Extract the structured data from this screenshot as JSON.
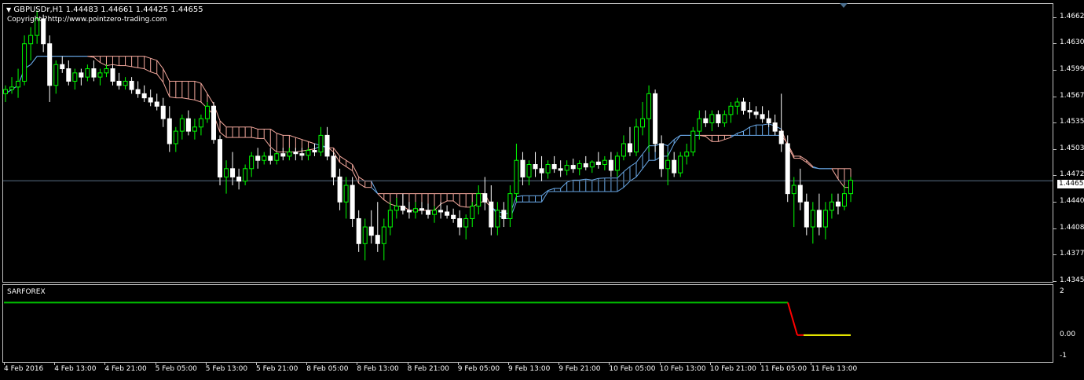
{
  "chart": {
    "symbol_line": "GBPUSDr,H1  1.44483 1.44661 1.44425 1.44655",
    "copyright": "Copyright ?http://www.pointzero-trading.com",
    "current_price": "1.44655",
    "colors": {
      "bull": "#00ff00",
      "bear": "#ffffff",
      "cloud_bull": "#6aa9e8",
      "cloud_bear": "#f5a99e",
      "sar_green": "#00c000",
      "sar_red": "#ff0000",
      "sar_yellow": "#ffff00"
    }
  },
  "price_axis": [
    "1.46620",
    "1.46305",
    "1.45990",
    "1.45670",
    "1.45355",
    "1.45035",
    "1.44720",
    "1.44405",
    "1.44085",
    "1.43770",
    "1.43450"
  ],
  "indicator": {
    "name": "SARFOREX",
    "axis": [
      "2",
      "0.00",
      "-1"
    ]
  },
  "time_axis": [
    "4 Feb 2016",
    "4 Feb 13:00",
    "4 Feb 21:00",
    "5 Feb 05:00",
    "5 Feb 13:00",
    "5 Feb 21:00",
    "8 Feb 05:00",
    "8 Feb 13:00",
    "8 Feb 21:00",
    "9 Feb 05:00",
    "9 Feb 13:00",
    "9 Feb 21:00",
    "10 Feb 05:00",
    "10 Feb 13:00",
    "10 Feb 21:00",
    "11 Feb 05:00",
    "11 Feb 13:00"
  ],
  "chart_data": {
    "type": "candlestick",
    "candles": [
      [
        1.457,
        1.458,
        1.456,
        1.4575
      ],
      [
        1.4575,
        1.459,
        1.457,
        1.4578
      ],
      [
        1.4578,
        1.46,
        1.4565,
        1.4585
      ],
      [
        1.4585,
        1.464,
        1.458,
        1.463
      ],
      [
        1.463,
        1.465,
        1.461,
        1.464
      ],
      [
        1.464,
        1.467,
        1.463,
        1.466
      ],
      [
        1.466,
        1.4665,
        1.462,
        1.463
      ],
      [
        1.463,
        1.464,
        1.456,
        1.458
      ],
      [
        1.458,
        1.461,
        1.457,
        1.4605
      ],
      [
        1.4605,
        1.4615,
        1.4595,
        1.46
      ],
      [
        1.46,
        1.461,
        1.458,
        1.4585
      ],
      [
        1.4585,
        1.46,
        1.4575,
        1.4595
      ],
      [
        1.4595,
        1.46,
        1.458,
        1.459
      ],
      [
        1.459,
        1.4605,
        1.4585,
        1.46
      ],
      [
        1.46,
        1.461,
        1.4585,
        1.459
      ],
      [
        1.459,
        1.46,
        1.458,
        1.4595
      ],
      [
        1.4595,
        1.4605,
        1.459,
        1.46
      ],
      [
        1.46,
        1.4605,
        1.458,
        1.4585
      ],
      [
        1.4585,
        1.4595,
        1.4575,
        1.458
      ],
      [
        1.458,
        1.459,
        1.4575,
        1.4585
      ],
      [
        1.4585,
        1.459,
        1.457,
        1.4575
      ],
      [
        1.4575,
        1.4585,
        1.4565,
        1.457
      ],
      [
        1.457,
        1.458,
        1.456,
        1.4565
      ],
      [
        1.4565,
        1.4575,
        1.4555,
        1.456
      ],
      [
        1.456,
        1.457,
        1.455,
        1.4555
      ],
      [
        1.4555,
        1.4565,
        1.453,
        1.454
      ],
      [
        1.454,
        1.4555,
        1.45,
        1.451
      ],
      [
        1.451,
        1.453,
        1.45,
        1.4525
      ],
      [
        1.4525,
        1.4545,
        1.4515,
        1.454
      ],
      [
        1.454,
        1.455,
        1.452,
        1.4525
      ],
      [
        1.4525,
        1.454,
        1.4515,
        1.453
      ],
      [
        1.453,
        1.4545,
        1.452,
        1.454
      ],
      [
        1.454,
        1.456,
        1.4535,
        1.4555
      ],
      [
        1.4555,
        1.456,
        1.451,
        1.4515
      ],
      [
        1.4515,
        1.452,
        1.446,
        1.447
      ],
      [
        1.447,
        1.449,
        1.445,
        1.448
      ],
      [
        1.448,
        1.45,
        1.446,
        1.447
      ],
      [
        1.447,
        1.448,
        1.4455,
        1.4465
      ],
      [
        1.4465,
        1.4485,
        1.446,
        1.448
      ],
      [
        1.448,
        1.45,
        1.447,
        1.4495
      ],
      [
        1.4495,
        1.4505,
        1.448,
        1.449
      ],
      [
        1.449,
        1.45,
        1.4485,
        1.4495
      ],
      [
        1.4495,
        1.4505,
        1.4485,
        1.449
      ],
      [
        1.449,
        1.45,
        1.4485,
        1.4498
      ],
      [
        1.4498,
        1.4505,
        1.449,
        1.4495
      ],
      [
        1.4495,
        1.4505,
        1.449,
        1.45
      ],
      [
        1.45,
        1.4505,
        1.449,
        1.4498
      ],
      [
        1.4498,
        1.4505,
        1.449,
        1.4496
      ],
      [
        1.4496,
        1.4505,
        1.449,
        1.4502
      ],
      [
        1.4502,
        1.451,
        1.4495,
        1.45
      ],
      [
        1.45,
        1.453,
        1.4495,
        1.452
      ],
      [
        1.452,
        1.453,
        1.449,
        1.4495
      ],
      [
        1.4495,
        1.45,
        1.446,
        1.447
      ],
      [
        1.447,
        1.448,
        1.443,
        1.444
      ],
      [
        1.444,
        1.447,
        1.442,
        1.446
      ],
      [
        1.446,
        1.447,
        1.441,
        1.442
      ],
      [
        1.442,
        1.443,
        1.438,
        1.439
      ],
      [
        1.439,
        1.442,
        1.437,
        1.441
      ],
      [
        1.441,
        1.443,
        1.439,
        1.44
      ],
      [
        1.44,
        1.444,
        1.438,
        1.439
      ],
      [
        1.439,
        1.442,
        1.437,
        1.441
      ],
      [
        1.441,
        1.444,
        1.44,
        1.443
      ],
      [
        1.443,
        1.4445,
        1.442,
        1.4435
      ],
      [
        1.4435,
        1.445,
        1.4425,
        1.443
      ],
      [
        1.443,
        1.444,
        1.442,
        1.4428
      ],
      [
        1.4428,
        1.444,
        1.442,
        1.4432
      ],
      [
        1.4432,
        1.444,
        1.4425,
        1.443
      ],
      [
        1.443,
        1.4438,
        1.442,
        1.4425
      ],
      [
        1.4425,
        1.4435,
        1.4415,
        1.443
      ],
      [
        1.443,
        1.444,
        1.442,
        1.4428
      ],
      [
        1.4428,
        1.4436,
        1.442,
        1.4424
      ],
      [
        1.4424,
        1.4432,
        1.4415,
        1.442
      ],
      [
        1.442,
        1.443,
        1.44,
        1.441
      ],
      [
        1.441,
        1.4425,
        1.4395,
        1.442
      ],
      [
        1.442,
        1.444,
        1.441,
        1.4435
      ],
      [
        1.4435,
        1.446,
        1.4425,
        1.445
      ],
      [
        1.445,
        1.447,
        1.443,
        1.444
      ],
      [
        1.444,
        1.446,
        1.44,
        1.441
      ],
      [
        1.441,
        1.444,
        1.44,
        1.443
      ],
      [
        1.443,
        1.444,
        1.441,
        1.442
      ],
      [
        1.442,
        1.446,
        1.441,
        1.445
      ],
      [
        1.445,
        1.451,
        1.444,
        1.449
      ],
      [
        1.449,
        1.45,
        1.446,
        1.447
      ],
      [
        1.447,
        1.449,
        1.446,
        1.4485
      ],
      [
        1.4485,
        1.45,
        1.447,
        1.448
      ],
      [
        1.448,
        1.4495,
        1.4465,
        1.4475
      ],
      [
        1.4475,
        1.449,
        1.4468,
        1.4485
      ],
      [
        1.4485,
        1.4495,
        1.4475,
        1.448
      ],
      [
        1.448,
        1.449,
        1.447,
        1.4478
      ],
      [
        1.4478,
        1.449,
        1.4472,
        1.4484
      ],
      [
        1.4484,
        1.4492,
        1.4475,
        1.448
      ],
      [
        1.448,
        1.449,
        1.4472,
        1.4486
      ],
      [
        1.4486,
        1.4495,
        1.4478,
        1.4482
      ],
      [
        1.4482,
        1.449,
        1.4475,
        1.4488
      ],
      [
        1.4488,
        1.45,
        1.448,
        1.4485
      ],
      [
        1.4485,
        1.4495,
        1.4478,
        1.449
      ],
      [
        1.449,
        1.45,
        1.447,
        1.4478
      ],
      [
        1.4478,
        1.45,
        1.447,
        1.4495
      ],
      [
        1.4495,
        1.452,
        1.449,
        1.451
      ],
      [
        1.451,
        1.453,
        1.4495,
        1.45
      ],
      [
        1.45,
        1.454,
        1.4495,
        1.453
      ],
      [
        1.453,
        1.456,
        1.452,
        1.454
      ],
      [
        1.454,
        1.458,
        1.45,
        1.457
      ],
      [
        1.457,
        1.4575,
        1.45,
        1.451
      ],
      [
        1.451,
        1.452,
        1.447,
        1.448
      ],
      [
        1.448,
        1.45,
        1.446,
        1.449
      ],
      [
        1.449,
        1.45,
        1.447,
        1.4475
      ],
      [
        1.4475,
        1.45,
        1.447,
        1.4495
      ],
      [
        1.4495,
        1.451,
        1.4485,
        1.45
      ],
      [
        1.45,
        1.453,
        1.4495,
        1.4525
      ],
      [
        1.4525,
        1.455,
        1.4515,
        1.454
      ],
      [
        1.454,
        1.455,
        1.453,
        1.4535
      ],
      [
        1.4535,
        1.455,
        1.4525,
        1.4545
      ],
      [
        1.4545,
        1.455,
        1.453,
        1.4535
      ],
      [
        1.4535,
        1.455,
        1.453,
        1.4545
      ],
      [
        1.4545,
        1.456,
        1.4535,
        1.4555
      ],
      [
        1.4555,
        1.4565,
        1.4545,
        1.456
      ],
      [
        1.456,
        1.4565,
        1.4545,
        1.455
      ],
      [
        1.455,
        1.456,
        1.454,
        1.4548
      ],
      [
        1.4548,
        1.4555,
        1.454,
        1.4545
      ],
      [
        1.4545,
        1.4555,
        1.4535,
        1.454
      ],
      [
        1.454,
        1.455,
        1.453,
        1.4535
      ],
      [
        1.4535,
        1.4545,
        1.452,
        1.4525
      ],
      [
        1.4525,
        1.457,
        1.45,
        1.451
      ],
      [
        1.451,
        1.452,
        1.444,
        1.445
      ],
      [
        1.445,
        1.447,
        1.441,
        1.446
      ],
      [
        1.446,
        1.448,
        1.443,
        1.444
      ],
      [
        1.444,
        1.445,
        1.44,
        1.441
      ],
      [
        1.441,
        1.444,
        1.439,
        1.443
      ],
      [
        1.443,
        1.445,
        1.44,
        1.441
      ],
      [
        1.441,
        1.444,
        1.4395,
        1.443
      ],
      [
        1.443,
        1.445,
        1.442,
        1.444
      ],
      [
        1.444,
        1.445,
        1.4425,
        1.4435
      ],
      [
        1.4435,
        1.446,
        1.443,
        1.445
      ],
      [
        1.445,
        1.447,
        1.444,
        1.4466
      ]
    ],
    "ylim": [
      1.4345,
      1.4675
    ],
    "sar_indicator": {
      "level_a": 1.5,
      "level_b": 0.0,
      "ylim": [
        -1.2,
        2.2
      ]
    }
  }
}
